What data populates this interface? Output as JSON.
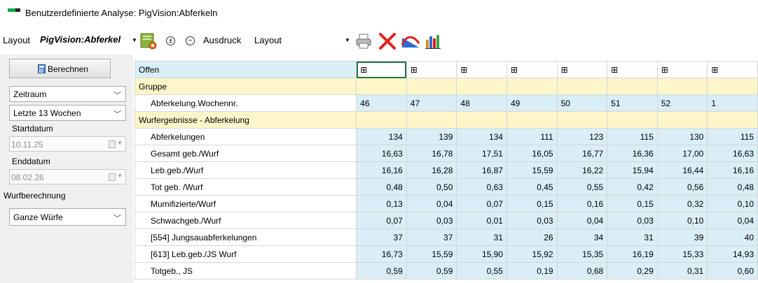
{
  "window": {
    "title": "Benutzerdefinierte Analyse: PigVision:Abferkeln"
  },
  "toolbar": {
    "layout_label": "Layout",
    "layout_name": "PigVision:Abferkel",
    "expand_symbol": "±",
    "collapse_symbol": "−",
    "print_label": "Ausdruck",
    "print_layout": "Layout",
    "icons": [
      "layout-settings-icon",
      "printer-icon",
      "delete-icon",
      "line-chart-icon",
      "bar-chart-icon"
    ]
  },
  "left_panel": {
    "calc_button": "Berechnen",
    "period_mode": "Zeitraum",
    "period_value": "Letzte 13 Wochen",
    "start_label": "Startdatum",
    "start_date": "10.11.25",
    "end_label": "Enddatum",
    "end_date": "08.02.26",
    "litter_calc_label": "Wurfberechnung",
    "litter_calc_value": "Ganze Würfe"
  },
  "grid": {
    "offen_label": "Offen",
    "group_label": "Gruppe",
    "week_label": "Abferkelung.Wochennr.",
    "weeks": [
      "46",
      "47",
      "48",
      "49",
      "50",
      "51",
      "52",
      "1"
    ],
    "section_label": "Wurfergebnisse - Abferkelung",
    "rows": [
      {
        "label": "Abferkelungen",
        "values": [
          "134",
          "139",
          "134",
          "111",
          "123",
          "115",
          "130",
          "115"
        ]
      },
      {
        "label": "Gesamt geb./Wurf",
        "values": [
          "16,63",
          "16,78",
          "17,51",
          "16,05",
          "16,77",
          "16,36",
          "17,00",
          "16,63"
        ]
      },
      {
        "label": "Leb.geb./Wurf",
        "values": [
          "16,16",
          "16,28",
          "16,87",
          "15,59",
          "16,22",
          "15,94",
          "16,44",
          "16,16"
        ]
      },
      {
        "label": "Tot geb. /Wurf",
        "values": [
          "0,48",
          "0,50",
          "0,63",
          "0,45",
          "0,55",
          "0,42",
          "0,56",
          "0,48"
        ]
      },
      {
        "label": "Mumifizierte/Wurf",
        "values": [
          "0,13",
          "0,04",
          "0,07",
          "0,15",
          "0,16",
          "0,15",
          "0,32",
          "0,10"
        ]
      },
      {
        "label": "Schwachgeb./Wurf",
        "values": [
          "0,07",
          "0,03",
          "0,01",
          "0,03",
          "0,04",
          "0,03",
          "0,10",
          "0,04"
        ]
      },
      {
        "label": "[554] Jungsauabferkelungen",
        "values": [
          "37",
          "37",
          "31",
          "26",
          "34",
          "31",
          "39",
          "40"
        ]
      },
      {
        "label": "[613] Leb.geb./JS Wurf",
        "values": [
          "16,73",
          "15,59",
          "15,90",
          "15,92",
          "15,35",
          "16,19",
          "15,33",
          "14,93"
        ]
      },
      {
        "label": "Totgeb., JS",
        "values": [
          "0,59",
          "0,59",
          "0,55",
          "0,19",
          "0,68",
          "0,29",
          "0,31",
          "0,60"
        ]
      }
    ]
  },
  "colors": {
    "selected_cell": "#217346",
    "data_cell": "#d9eef6",
    "section_row": "#fdf6c8"
  }
}
